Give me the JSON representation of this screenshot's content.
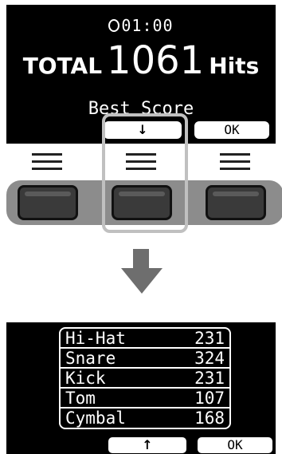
{
  "top_screen": {
    "timer": "01:00",
    "total_label": "TOTAL",
    "total_value": "1061",
    "total_unit": "Hits",
    "best_score": "Best Score",
    "softkeys": {
      "down": "↓",
      "ok": "OK"
    }
  },
  "bottom_screen": {
    "rows": [
      {
        "name": "Hi-Hat",
        "value": "231"
      },
      {
        "name": "Snare",
        "value": "324"
      },
      {
        "name": "Kick",
        "value": "231"
      },
      {
        "name": "Tom",
        "value": "107"
      },
      {
        "name": "Cymbal",
        "value": "168"
      }
    ],
    "softkeys": {
      "up": "↑",
      "ok": "OK"
    }
  },
  "colors": {
    "screen_bg": "#000000",
    "screen_text": "#ffffff",
    "button_bar": "#8c8c8c",
    "highlight": "#c0c0c0",
    "arrow": "#6e6e6e"
  }
}
